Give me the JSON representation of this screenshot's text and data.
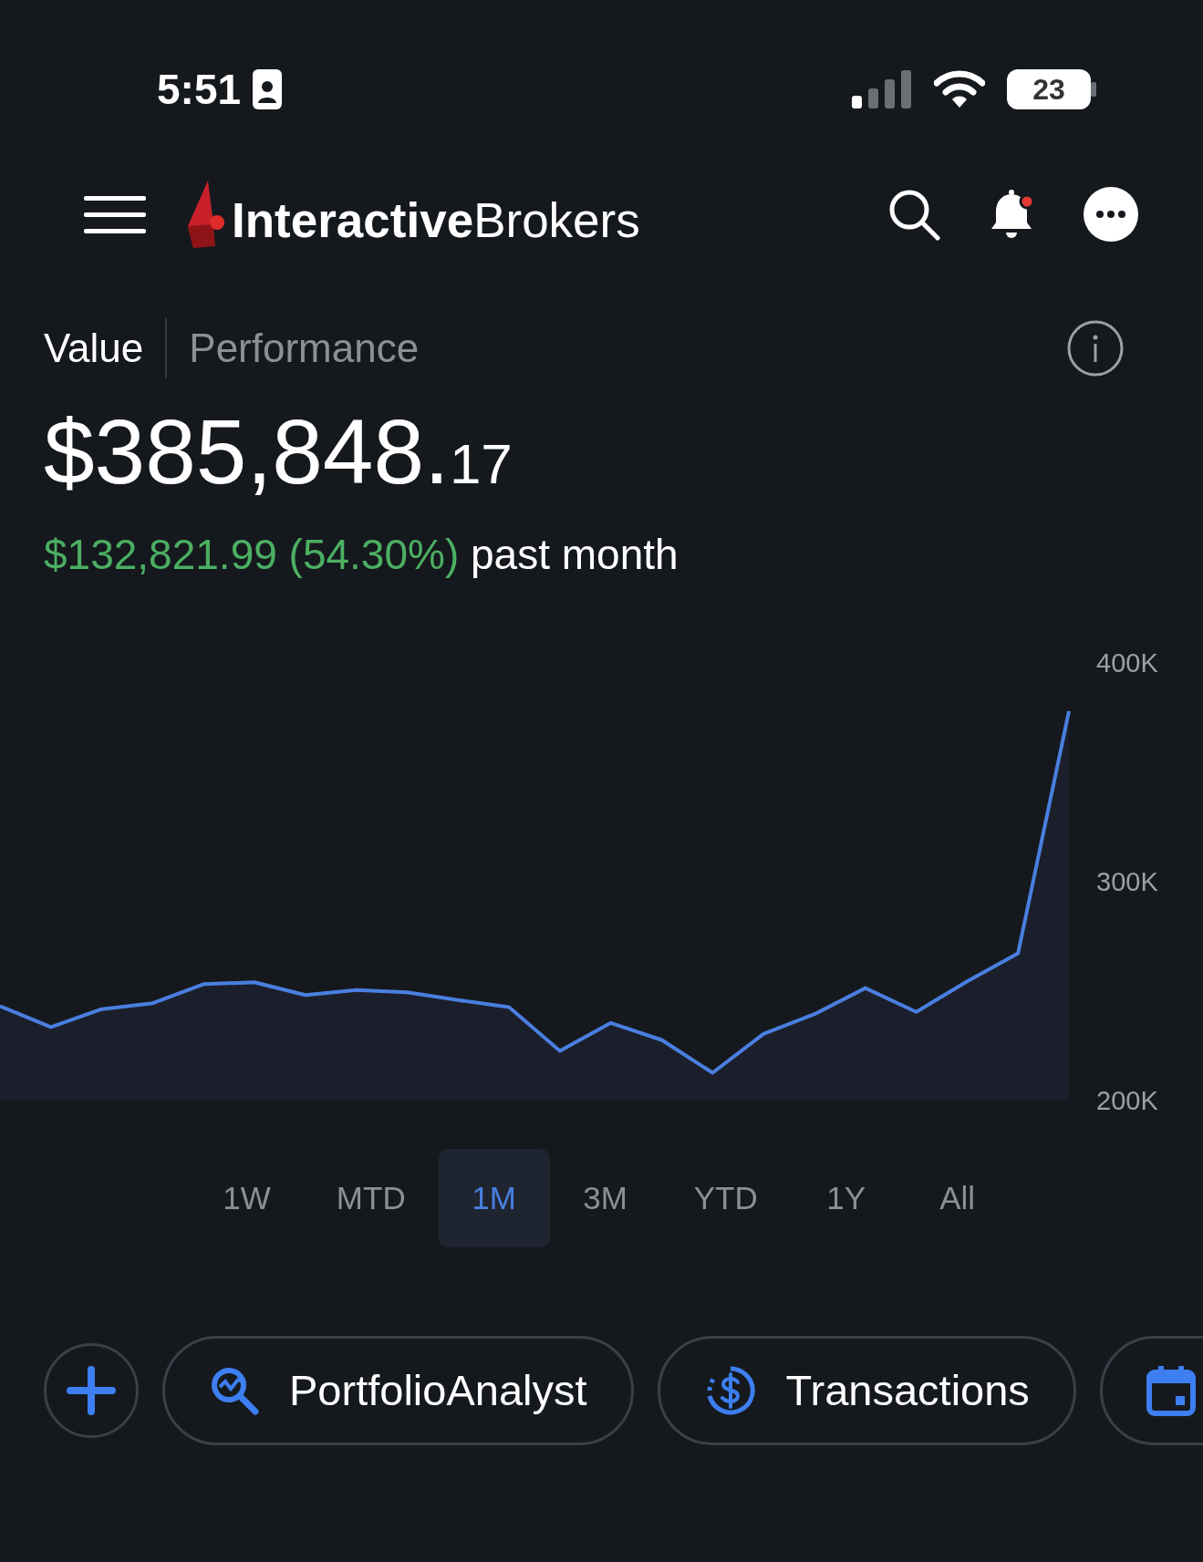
{
  "status_bar": {
    "time": "5:51",
    "battery": "23"
  },
  "header": {
    "logo_text": "**Interactive**Brokers",
    "notification": true
  },
  "tabs": [
    {
      "label": "Value",
      "selected": true
    },
    {
      "label": "Performance",
      "selected": false
    }
  ],
  "value": {
    "amount": "$385,848.",
    "cents": "17"
  },
  "change": {
    "amount": "$132,821.99 (54.30%)",
    "period": "past month"
  },
  "chart": {
    "chart_data": {
      "type": "area",
      "ylim": [
        200000,
        400000
      ],
      "yticks": [
        {
          "value": 400000,
          "label": "400K"
        },
        {
          "value": 300000,
          "label": "300K"
        },
        {
          "value": 200000,
          "label": "200K"
        }
      ],
      "series": [
        {
          "color": "#4a7fe0",
          "values": [
            243200,
            233600,
            241800,
            244500,
            253200,
            254100,
            248200,
            250500,
            249500,
            245900,
            242700,
            222700,
            235500,
            227700,
            212700,
            230500,
            239500,
            251400,
            240500,
            254500,
            267300,
            378000
          ]
        }
      ]
    }
  },
  "ranges": [
    {
      "label": "1W",
      "selected": false
    },
    {
      "label": "MTD",
      "selected": false
    },
    {
      "label": "1M",
      "selected": true
    },
    {
      "label": "3M",
      "selected": false
    },
    {
      "label": "YTD",
      "selected": false
    },
    {
      "label": "1Y",
      "selected": false
    },
    {
      "label": "All",
      "selected": false
    }
  ],
  "actions": [
    {
      "kind": "add"
    },
    {
      "kind": "analyst",
      "label": "PortfolioAnalyst"
    },
    {
      "kind": "transactions",
      "label": "Transactions"
    },
    {
      "kind": "calendar"
    }
  ]
}
